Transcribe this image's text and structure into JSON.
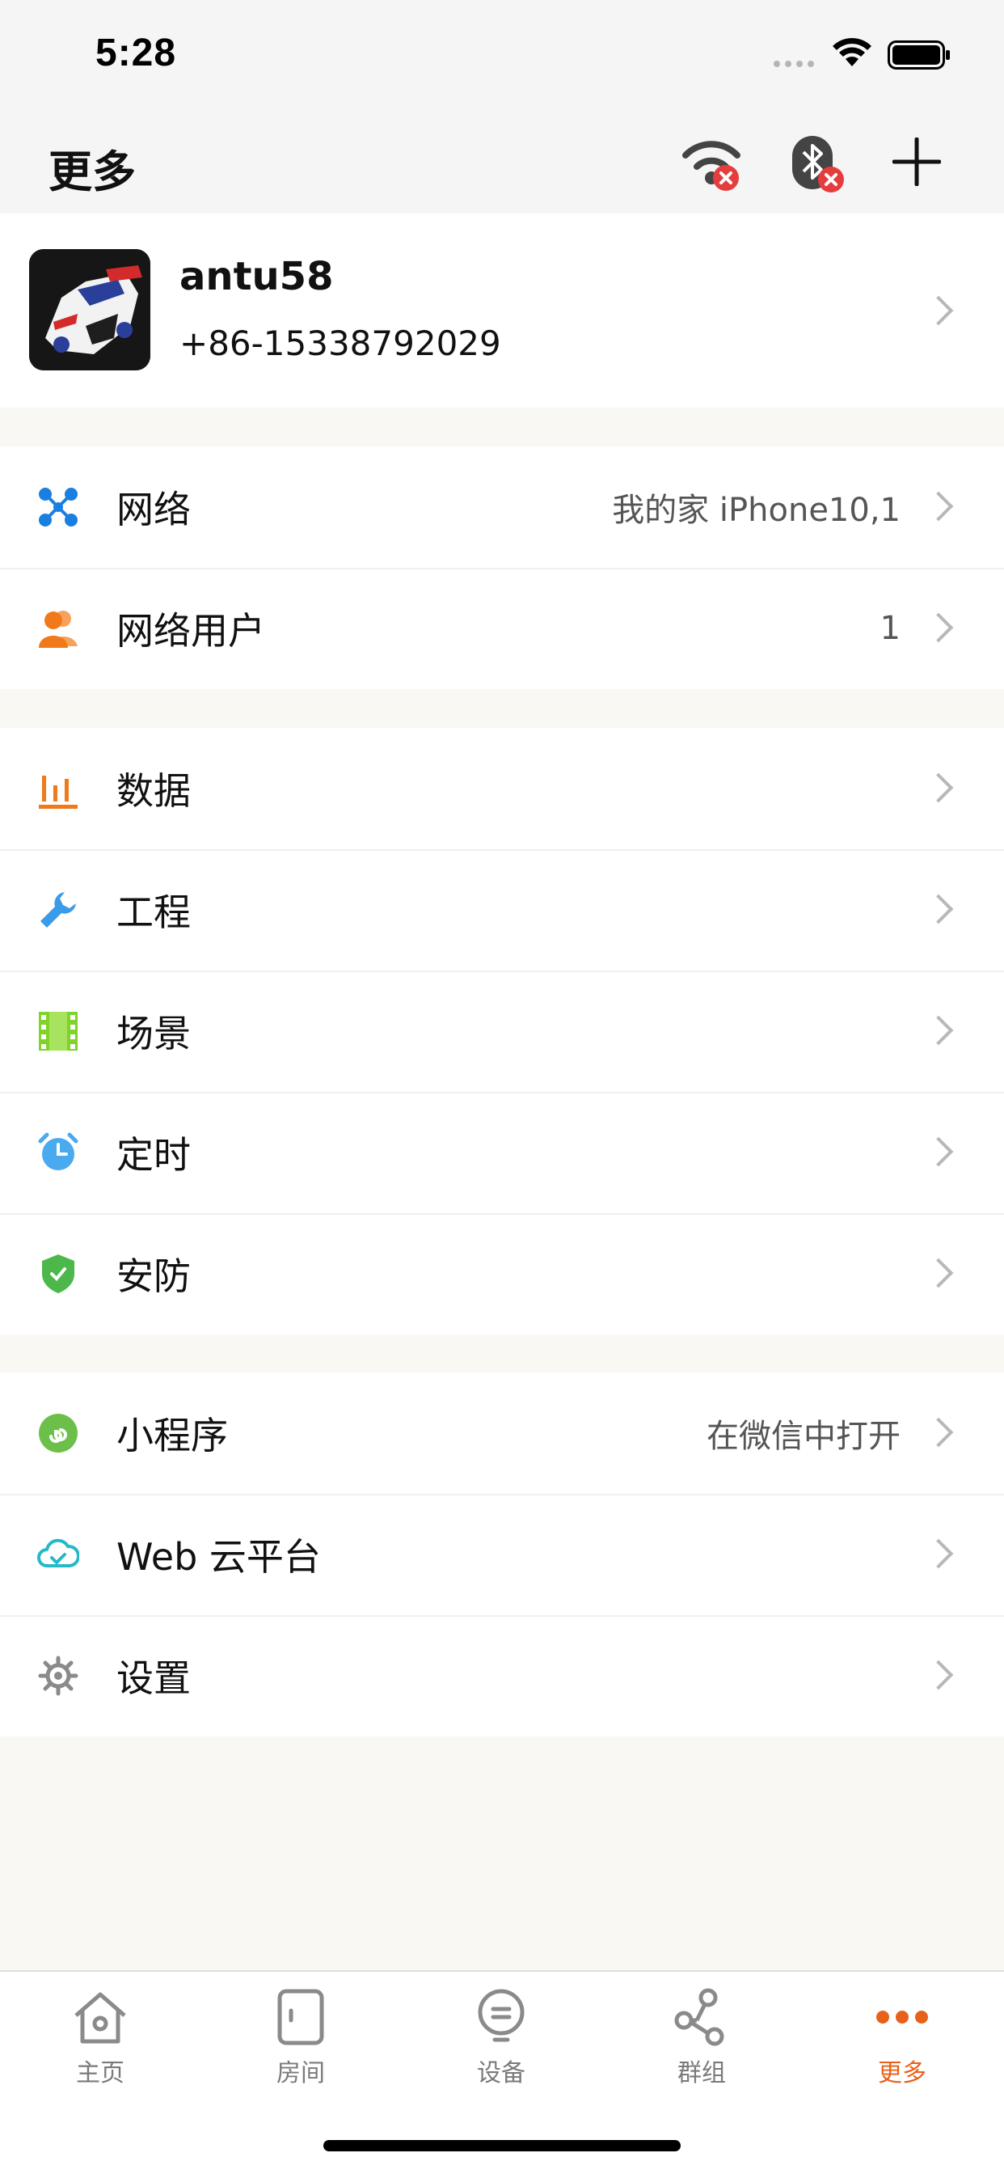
{
  "status_bar": {
    "time": "5:28"
  },
  "nav": {
    "title": "更多",
    "icons": [
      "wifi-disconnected-icon",
      "bluetooth-disconnected-icon",
      "plus-icon"
    ]
  },
  "profile": {
    "name": "antu58",
    "phone": "+86-15338792029"
  },
  "sections": {
    "network": [
      {
        "label": "网络",
        "value": "我的家 iPhone10,1",
        "icon": "network-icon",
        "color": "#1a7fe0"
      },
      {
        "label": "网络用户",
        "value": "1",
        "icon": "users-icon",
        "color": "#f07a1a"
      }
    ],
    "features": [
      {
        "label": "数据",
        "icon": "data-chart-icon",
        "color": "#f07a1a"
      },
      {
        "label": "工程",
        "icon": "wrench-icon",
        "color": "#3a9be8"
      },
      {
        "label": "场景",
        "icon": "film-icon",
        "color": "#7fd32a"
      },
      {
        "label": "定时",
        "icon": "alarm-clock-icon",
        "color": "#4aaaf0"
      },
      {
        "label": "安防",
        "icon": "shield-icon",
        "color": "#4cb84c"
      }
    ],
    "more": [
      {
        "label": "小程序",
        "value": "在微信中打开",
        "icon": "mini-program-icon",
        "color": "#6cc04a"
      },
      {
        "label": "Web 云平台",
        "icon": "cloud-icon",
        "color": "#25b9c8"
      },
      {
        "label": "设置",
        "icon": "gear-icon",
        "color": "#8a8a8a"
      }
    ]
  },
  "tabs": [
    {
      "label": "主页",
      "icon": "home-icon"
    },
    {
      "label": "房间",
      "icon": "door-icon"
    },
    {
      "label": "设备",
      "icon": "device-icon"
    },
    {
      "label": "群组",
      "icon": "group-icon"
    },
    {
      "label": "更多",
      "icon": "more-dots-icon",
      "active": true
    }
  ],
  "colors": {
    "accent": "#e8611a",
    "background": "#faf8f3"
  }
}
